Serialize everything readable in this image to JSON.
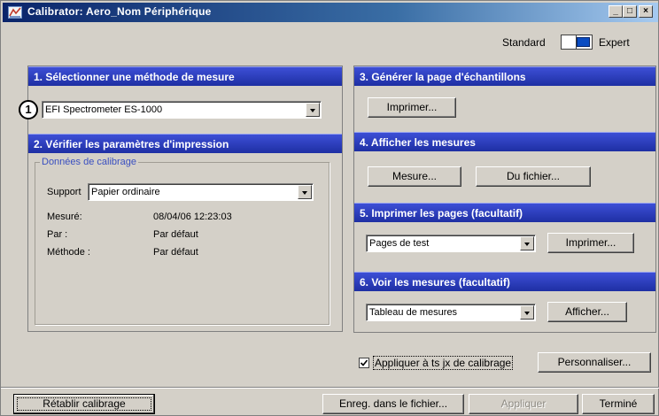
{
  "window": {
    "title": "Calibrator: Aero_Nom Périphérique",
    "minimize_glyph": "_",
    "maximize_glyph": "□",
    "close_glyph": "×"
  },
  "mode": {
    "standard_label": "Standard",
    "expert_label": "Expert",
    "selected": "Expert"
  },
  "section1": {
    "title": "1. Sélectionner une méthode de mesure",
    "badge": "1",
    "method_value": "EFI Spectrometer ES-1000"
  },
  "section2": {
    "title": "2. Vérifier les paramètres d'impression",
    "group_title": "Données de calibrage",
    "support_label": "Support",
    "support_value": "Papier ordinaire",
    "measured_label": "Mesuré:",
    "measured_value": "08/04/06  12:23:03",
    "by_label": "Par :",
    "by_value": "Par défaut",
    "method_label": "Méthode :",
    "method_value": "Par défaut"
  },
  "section3": {
    "title": "3. Générer la page d'échantillons",
    "print_button": "Imprimer..."
  },
  "section4": {
    "title": "4. Afficher les mesures",
    "measure_button": "Mesure...",
    "file_button": "Du fichier..."
  },
  "section5": {
    "title": "5. Imprimer les pages (facultatif)",
    "pages_value": "Pages de test",
    "print_button": "Imprimer..."
  },
  "section6": {
    "title": "6. Voir les mesures (facultatif)",
    "view_value": "Tableau de mesures",
    "show_button": "Afficher..."
  },
  "apply_all": {
    "label": "Appliquer à ts jx de calibrage",
    "checked": true
  },
  "customize_button": "Personnaliser...",
  "footer": {
    "reset_button": "Rétablir calibrage",
    "save_button": "Enreg. dans le fichier...",
    "apply_button": "Appliquer",
    "done_button": "Terminé"
  },
  "colors": {
    "header_blue": "#1e2fa3",
    "titlebar_blue": "#0a246a",
    "group_title_blue": "#3a4fc0"
  }
}
